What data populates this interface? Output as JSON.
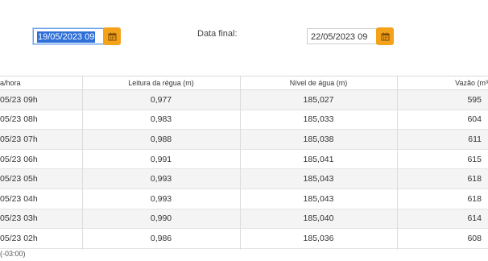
{
  "filters": {
    "start_date_value": "19/05/2023 09",
    "end_label": "Data final:",
    "end_date_value": "22/05/2023 09"
  },
  "table": {
    "headers": [
      "a/hora",
      "Leitura da régua (m)",
      "Nível de água (m)",
      "Vazão (m³"
    ],
    "rows": [
      [
        "05/23 09h",
        "0,977",
        "185,027",
        "595"
      ],
      [
        "05/23 08h",
        "0,983",
        "185,033",
        "604"
      ],
      [
        "05/23 07h",
        "0,988",
        "185,038",
        "611"
      ],
      [
        "05/23 06h",
        "0,991",
        "185,041",
        "615"
      ],
      [
        "05/23 05h",
        "0,993",
        "185,043",
        "618"
      ],
      [
        "05/23 04h",
        "0,993",
        "185,043",
        "618"
      ],
      [
        "05/23 03h",
        "0,990",
        "185,040",
        "614"
      ],
      [
        "05/23 02h",
        "0,986",
        "185,036",
        "608"
      ]
    ]
  },
  "footer": {
    "timezone": "(-03:00)"
  },
  "colors": {
    "accent": "#f5a21b",
    "selection": "#2e6fd8"
  },
  "icons": {
    "calendar": "calendar-icon"
  }
}
